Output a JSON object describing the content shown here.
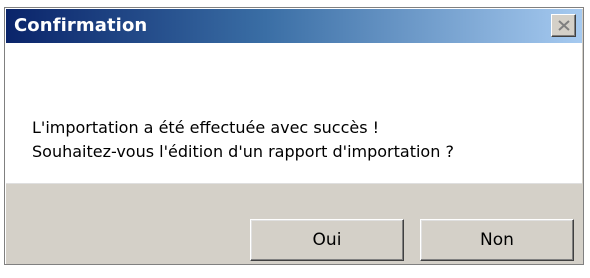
{
  "window": {
    "title": "Confirmation",
    "close_icon": "close-icon"
  },
  "message": {
    "line1": "L'importation a été effectuée avec succès !",
    "line2": "Souhaitez-vous l'édition d'un rapport d'importation ?"
  },
  "buttons": {
    "yes_label": "Oui",
    "no_label": "Non"
  },
  "colors": {
    "titlebar_start": "#0a246a",
    "titlebar_end": "#a6caf0",
    "dialog_face": "#d4d0c8"
  }
}
